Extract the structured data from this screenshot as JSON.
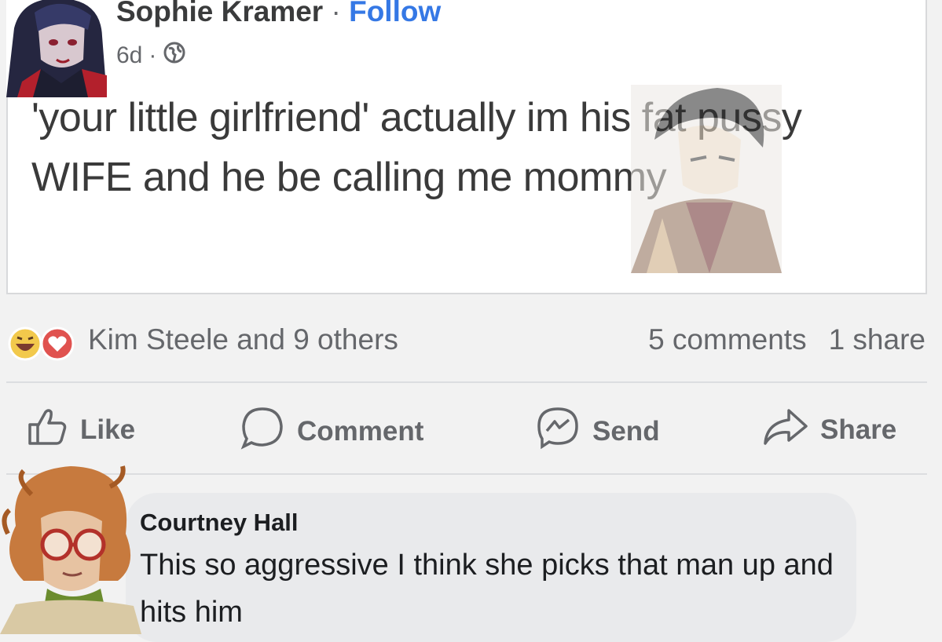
{
  "post": {
    "author": "Sophie Kramer",
    "separator": "·",
    "follow_label": "Follow",
    "time": "6d",
    "time_separator": "·",
    "text": "'your little girlfriend' actually im his fat pussy WIFE and he be calling me mommy"
  },
  "reactions": {
    "icons": [
      "haha-emoji-icon",
      "love-heart-icon"
    ],
    "names": "Kim Steele and 9 others",
    "comments": "5 comments",
    "shares": "1 share"
  },
  "actions": {
    "like": "Like",
    "comment": "Comment",
    "send": "Send",
    "share": "Share"
  },
  "comment": {
    "author": "Courtney Hall",
    "text": "This so aggressive I think she picks that man up and hits him"
  },
  "colors": {
    "follow_link": "#3578e5",
    "muted_text": "#65676b",
    "bubble": "#e9eaec"
  }
}
